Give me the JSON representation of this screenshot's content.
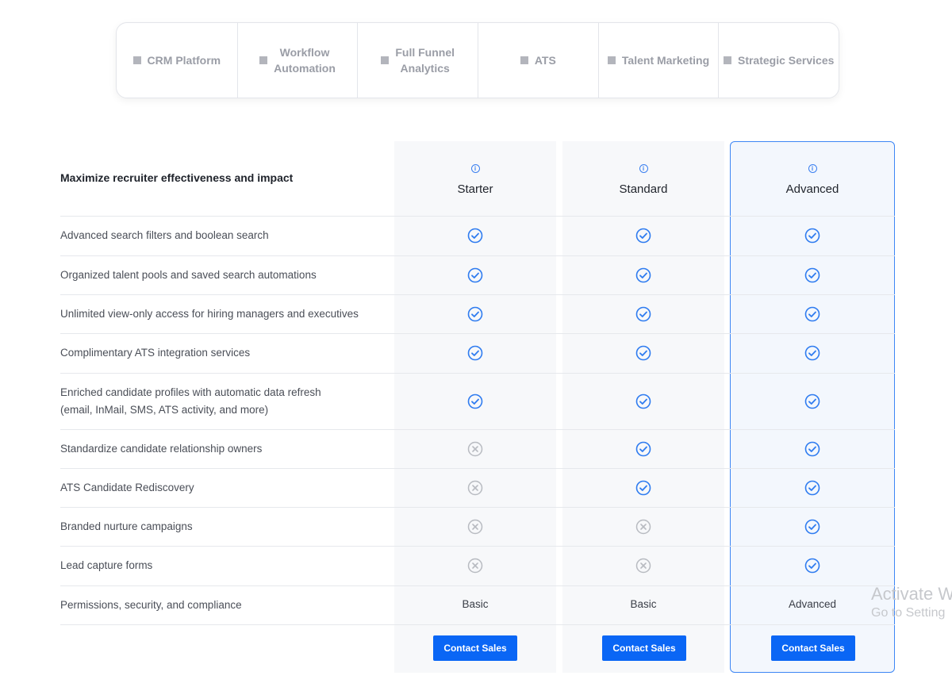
{
  "tabs": [
    {
      "label": "CRM Platform",
      "active": true
    },
    {
      "label": "Workflow\nAutomation",
      "active": false
    },
    {
      "label": "Full Funnel\nAnalytics",
      "active": false
    },
    {
      "label": "ATS",
      "active": false
    },
    {
      "label": "Talent Marketing",
      "active": false
    },
    {
      "label": "Strategic Services",
      "active": false
    }
  ],
  "section_title": "Maximize recruiter effectiveness and impact",
  "plans": [
    "Starter",
    "Standard",
    "Advanced"
  ],
  "info_icon_glyph": "i",
  "features": [
    {
      "label": "Advanced search filters and boolean search",
      "values": [
        "check",
        "check",
        "check"
      ]
    },
    {
      "label": "Organized talent pools and saved search automations",
      "values": [
        "check",
        "check",
        "check"
      ]
    },
    {
      "label": "Unlimited view-only access for hiring managers and executives",
      "values": [
        "check",
        "check",
        "check"
      ]
    },
    {
      "label": "Complimentary ATS integration services",
      "values": [
        "check",
        "check",
        "check"
      ]
    },
    {
      "label": "Enriched candidate profiles with automatic data refresh\n(email, InMail, SMS, ATS activity, and more)",
      "values": [
        "check",
        "check",
        "check"
      ]
    },
    {
      "label": "Standardize candidate relationship owners",
      "values": [
        "cross",
        "check",
        "check"
      ]
    },
    {
      "label": "ATS Candidate Rediscovery",
      "values": [
        "cross",
        "check",
        "check"
      ]
    },
    {
      "label": "Branded nurture campaigns",
      "values": [
        "cross",
        "cross",
        "check"
      ]
    },
    {
      "label": "Lead capture forms",
      "values": [
        "cross",
        "cross",
        "check"
      ]
    },
    {
      "label": "Permissions, security, and compliance",
      "values": [
        "Basic",
        "Basic",
        "Advanced"
      ]
    }
  ],
  "cta_label": "Contact Sales",
  "watermark": {
    "line1": "Activate W",
    "line2": "Go to Setting"
  },
  "colors": {
    "accent": "#0f67f7",
    "check": "#2f7cf0",
    "cross": "#b8bbc1"
  }
}
